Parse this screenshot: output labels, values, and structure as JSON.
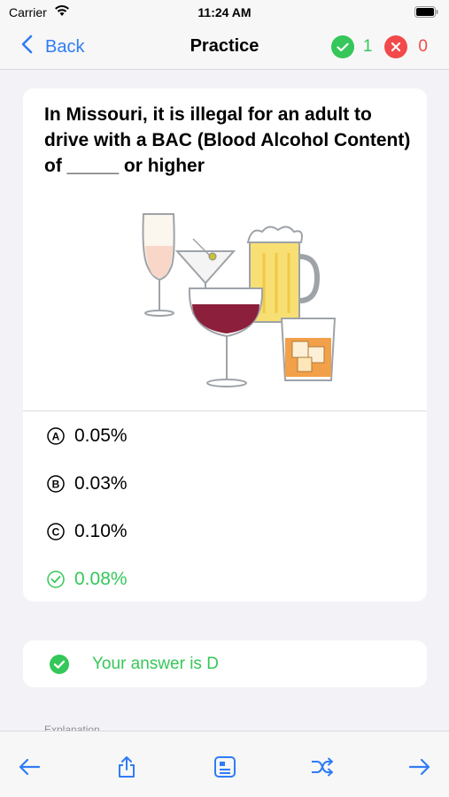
{
  "status_bar": {
    "carrier": "Carrier",
    "time": "11:24 AM"
  },
  "nav": {
    "back_label": "Back",
    "title": "Practice",
    "correct_count": "1",
    "wrong_count": "0"
  },
  "question": {
    "text": "In Missouri, it is illegal for an adult to drive with a BAC (Blood Alcohol Content) of _____ or higher",
    "image_icon": "alcoholic-drinks-illustration",
    "options": [
      {
        "letter": "A",
        "text": "0.05%"
      },
      {
        "letter": "B",
        "text": "0.03%"
      },
      {
        "letter": "C",
        "text": "0.10%"
      },
      {
        "letter": "D",
        "text": "0.08%",
        "correct": true
      }
    ]
  },
  "result": {
    "text": "Your answer is D"
  },
  "explanation": {
    "label": "Explanation"
  },
  "toolbar": {
    "icons": [
      "arrow-left-icon",
      "share-icon",
      "card-icon",
      "shuffle-icon",
      "arrow-right-icon"
    ]
  },
  "colors": {
    "accent": "#2f7cf6",
    "correct": "#35c759",
    "wrong": "#f24a4a"
  }
}
